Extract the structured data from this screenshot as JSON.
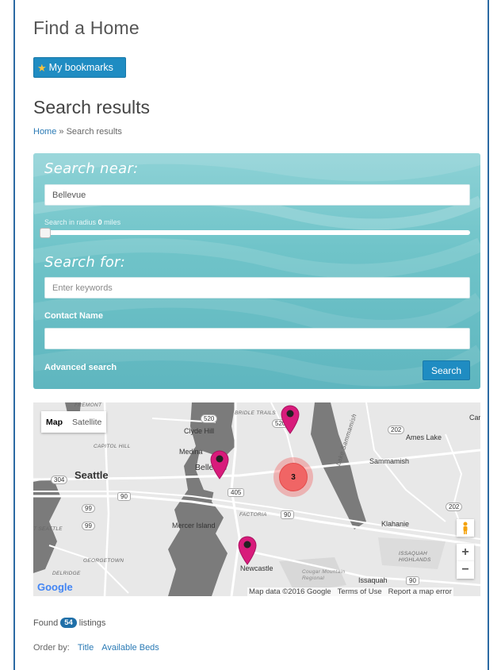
{
  "page": {
    "heading": "Find a Home",
    "bookmarks_label": "My bookmarks",
    "results_title": "Search results"
  },
  "breadcrumb": {
    "home": "Home",
    "separator": "»",
    "current": "Search results"
  },
  "search": {
    "near_label": "Search near:",
    "near_value": "Bellevue",
    "radius_prefix": "Search in radius",
    "radius_value": "0",
    "radius_unit": "miles",
    "for_label": "Search for:",
    "keywords_placeholder": "Enter keywords",
    "contact_label": "Contact Name",
    "contact_value": "",
    "advanced_label": "Advanced search",
    "button_label": "Search"
  },
  "map": {
    "type_map": "Map",
    "type_satellite": "Satellite",
    "cluster_count": "3",
    "labels": {
      "seattle": "Seattle",
      "bellevue": "Bellevue",
      "clyde_hill": "Clyde Hill",
      "medina": "Medina",
      "mercer_island": "Mercer Island",
      "sammamish": "Sammamish",
      "ames_lake": "Ames Lake",
      "klahanie": "Klahanie",
      "newcastle": "Newcastle",
      "issaquah": "Issaquah",
      "lake_sammamish": "Lake Sammamish",
      "bridle_trails": "BRIDLE TRAILS",
      "capitol_hill": "CAPITOL HILL",
      "factoria": "FACTORIA",
      "georgetown": "GEORGETOWN",
      "delridge": "DELRIDGE",
      "issaquah_highlands": "ISSAQUAH HIGHLANDS",
      "fremont": "FREMONT",
      "cougar_mountain": "Cougar Mountain Regional",
      "west_seattle": "T SEATTLE",
      "car": "Car"
    },
    "highway_shields": [
      "520",
      "520",
      "405",
      "90",
      "90",
      "99",
      "99",
      "202",
      "202",
      "304",
      "90"
    ],
    "google": "Google",
    "attribution": [
      "Map data ©2016 Google",
      "Terms of Use",
      "Report a map error"
    ],
    "zoom_in": "+",
    "zoom_out": "−"
  },
  "results": {
    "found_prefix": "Found",
    "count": "54",
    "found_suffix": "listings",
    "order_label": "Order by:",
    "order_options": [
      "Title",
      "Available Beds"
    ]
  }
}
